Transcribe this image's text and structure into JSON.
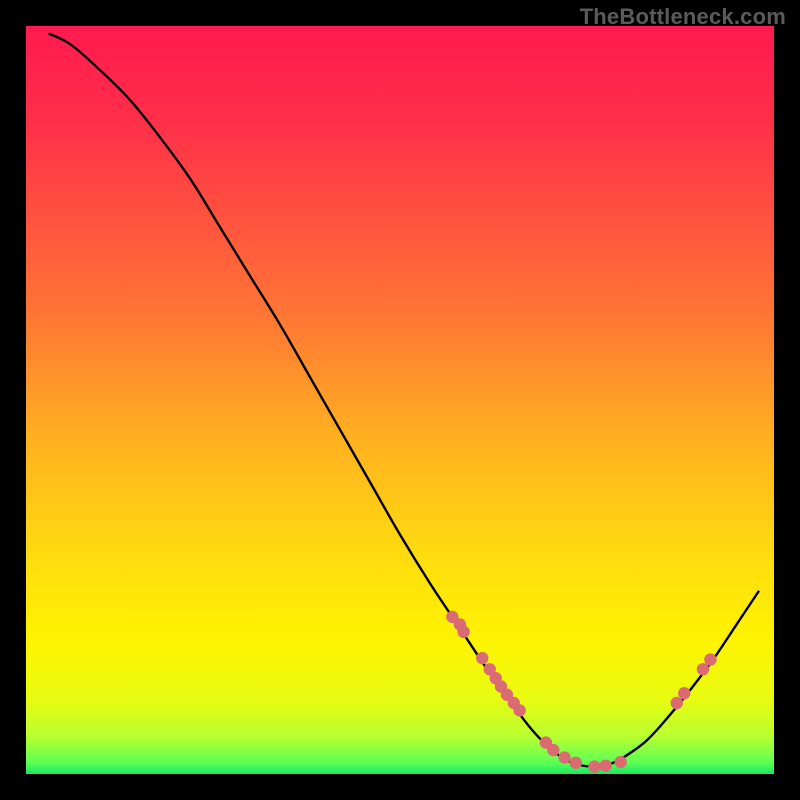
{
  "watermark": "TheBottleneck.com",
  "chart_data": {
    "type": "line",
    "title": "",
    "xlabel": "",
    "ylabel": "",
    "xlim": [
      0,
      100
    ],
    "ylim": [
      0,
      100
    ],
    "grid": false,
    "legend": false,
    "gradient_stops": [
      {
        "offset": 0.0,
        "color": "#ff1a4f"
      },
      {
        "offset": 0.12,
        "color": "#ff2d4a"
      },
      {
        "offset": 0.25,
        "color": "#ff5040"
      },
      {
        "offset": 0.4,
        "color": "#ff7a33"
      },
      {
        "offset": 0.55,
        "color": "#ffb020"
      },
      {
        "offset": 0.7,
        "color": "#ffd910"
      },
      {
        "offset": 0.82,
        "color": "#fff400"
      },
      {
        "offset": 0.9,
        "color": "#e8fb10"
      },
      {
        "offset": 0.95,
        "color": "#b8ff30"
      },
      {
        "offset": 0.985,
        "color": "#5cff55"
      },
      {
        "offset": 1.0,
        "color": "#18e860"
      }
    ],
    "series": [
      {
        "name": "bottleneck-curve",
        "x": [
          3,
          6,
          10,
          14,
          18,
          22,
          26,
          30,
          34,
          38,
          42,
          46,
          50,
          54,
          58,
          62,
          66,
          68,
          70,
          72,
          74,
          76,
          78,
          80,
          83,
          86,
          89,
          92,
          95,
          98
        ],
        "y": [
          99,
          97.5,
          94,
          90,
          85,
          79.5,
          73,
          66.5,
          60,
          53,
          46,
          39,
          32,
          25.5,
          19.5,
          13.5,
          8,
          5.5,
          3.5,
          2,
          1.2,
          1,
          1.3,
          2.3,
          4.5,
          7.8,
          11.5,
          15.5,
          20,
          24.5
        ]
      }
    ],
    "points": {
      "name": "highlighted-points",
      "color": "#db6b73",
      "radius_px": 6.2,
      "x": [
        57,
        58,
        58.5,
        61,
        62,
        62.8,
        63.5,
        64.3,
        65.2,
        66,
        69.5,
        70.5,
        72,
        73.5,
        76,
        77.5,
        79.5,
        87,
        88,
        90.5,
        91.5
      ],
      "y": [
        21,
        20,
        19,
        15.5,
        14,
        12.8,
        11.7,
        10.6,
        9.5,
        8.5,
        4.2,
        3.2,
        2.2,
        1.5,
        1.0,
        1.1,
        1.6,
        9.5,
        10.8,
        14,
        15.3
      ]
    }
  }
}
